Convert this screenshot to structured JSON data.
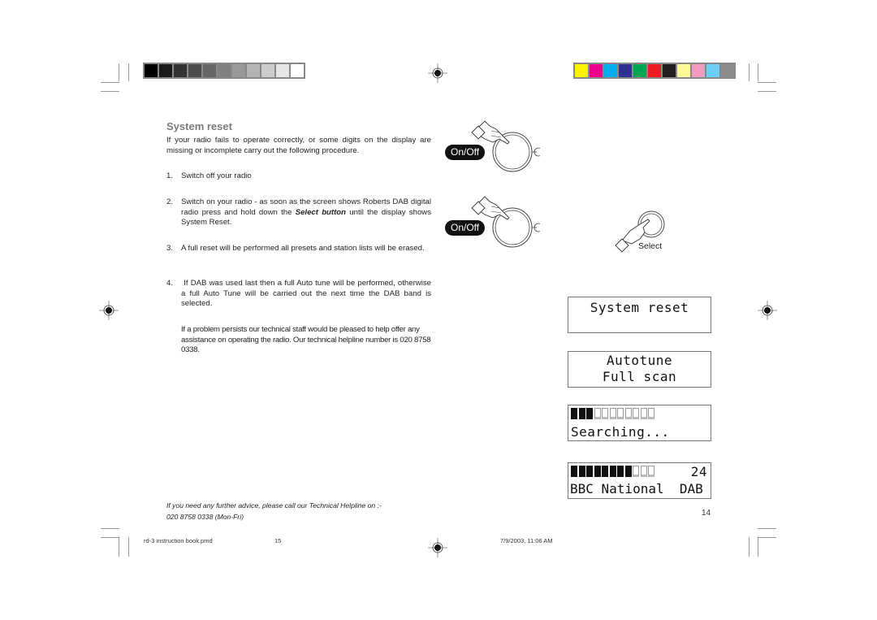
{
  "color_bars": {
    "grayscale": [
      "#000000",
      "#1a1a1a",
      "#333333",
      "#4d4d4d",
      "#666666",
      "#808080",
      "#999999",
      "#b3b3b3",
      "#cccccc",
      "#e6e6e6",
      "#ffffff"
    ],
    "process": [
      "#fff200",
      "#ec008c",
      "#00aeef",
      "#2e3192",
      "#00a651",
      "#ed1c24",
      "#231f20",
      "#fff799",
      "#f49ac1",
      "#6dcff6",
      "#8c8c8c"
    ]
  },
  "section": {
    "title": "System reset",
    "intro": "If your radio fails to operate correctly, or some digits on the display are missing or incomplete carry out the following procedure.",
    "steps": [
      {
        "num": "1.",
        "text": "Switch off your radio"
      },
      {
        "num": "2.",
        "text_before": "Switch on your radio - as soon as the screen shows Roberts DAB digital radio press and hold down the ",
        "text_bold": "Select button",
        "text_after": " until the display shows System Reset."
      },
      {
        "num": "3.",
        "text": "A full reset will be performed all presets and station lists will be erased."
      },
      {
        "num": "4.",
        "text": " If DAB was used last then a full Auto tune will be performed, otherwise a full Auto Tune will be carried out the next time the DAB band is selected."
      }
    ],
    "help_text": "If a problem persists our technical staff would be pleased to help offer any assistance on operating the radio. Our technical helpline number is 020 8758 0338."
  },
  "figures": {
    "onoff_label": "On/Off",
    "select_label": "Select"
  },
  "displays": [
    {
      "line1": "System reset",
      "line2": ""
    },
    {
      "line1": "Autotune",
      "line2": "Full scan"
    },
    {
      "progress_filled": 3,
      "progress_total": 11,
      "line2": "Searching..."
    },
    {
      "progress_filled": 8,
      "progress_total": 11,
      "count": "24",
      "line2": "BBC National  DAB"
    }
  ],
  "footer": {
    "advice_line1": "If you need any further advice, please call our Technical Helpline on :-",
    "advice_line2": "020 8758 0338 (Mon-Fri)",
    "page_number": "14"
  },
  "slug": {
    "filename": "rd-3 instruction book.pmd",
    "sheet": "15",
    "timestamp": "7/9/2003, 11:06 AM"
  }
}
